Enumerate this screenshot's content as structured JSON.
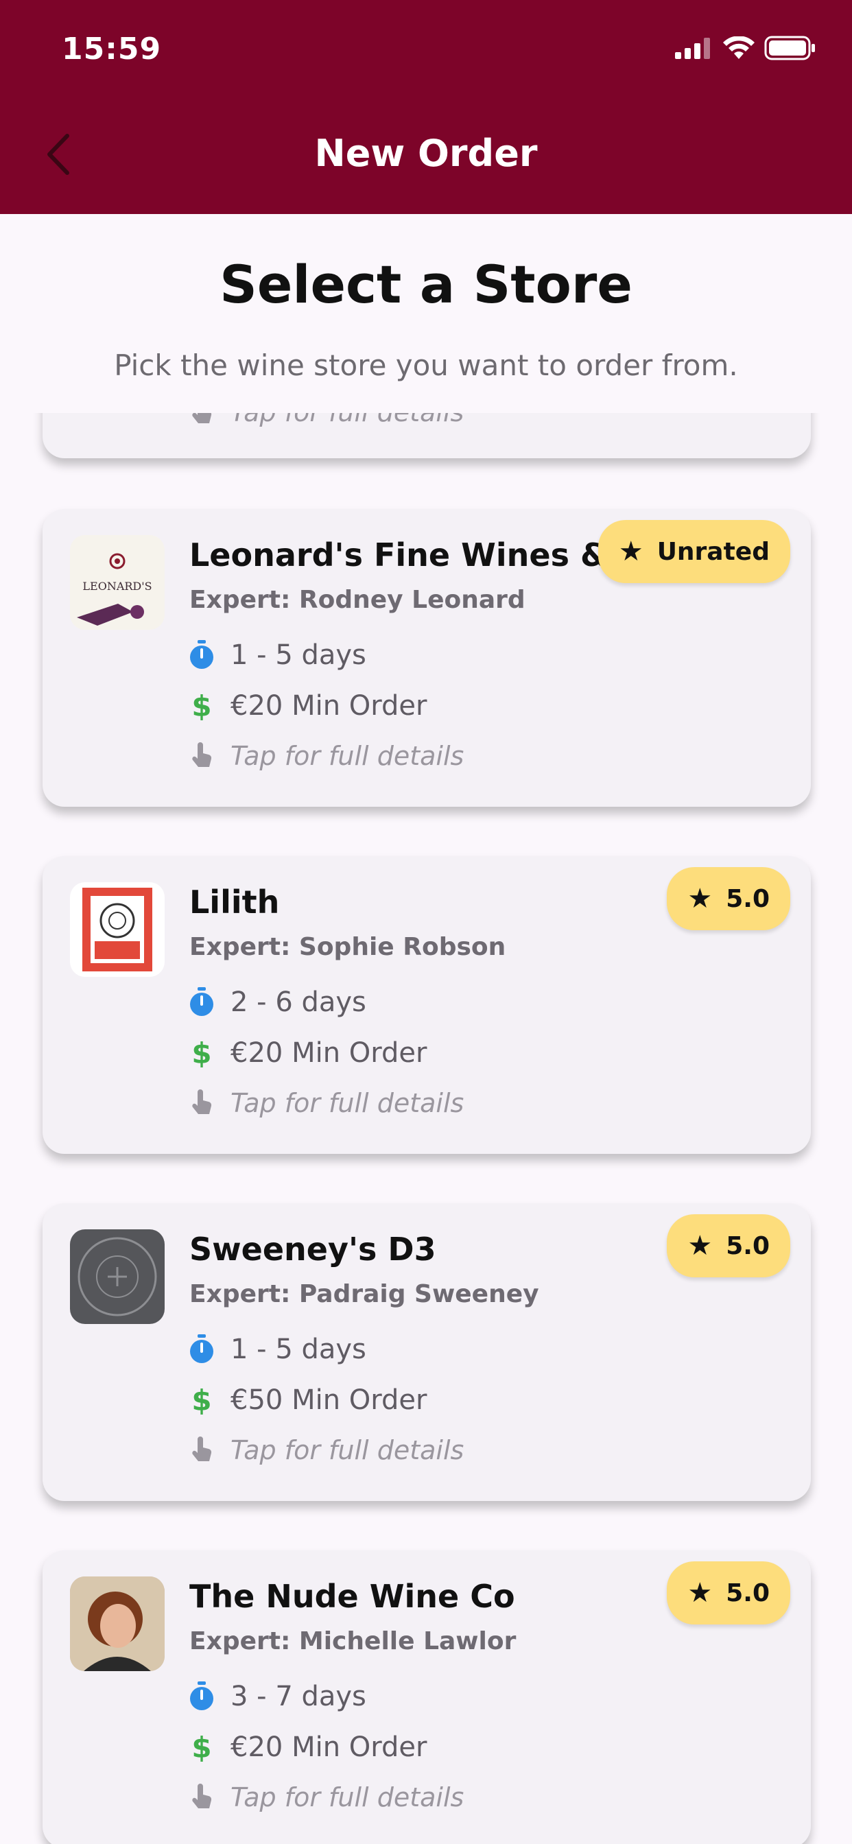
{
  "status_bar": {
    "time": "15:59"
  },
  "appbar": {
    "title": "New Order"
  },
  "header": {
    "title": "Select a Store",
    "subtitle": "Pick the wine store you want to order from."
  },
  "partial_card": {
    "tap_hint": "Tap for full details"
  },
  "stores": [
    {
      "name": "Leonard's Fine Wines &",
      "expert": "Expert: Rodney Leonard",
      "delivery": "1 - 5 days",
      "min_order": "€20 Min Order",
      "tap_hint": "Tap for full details",
      "rating": "Unrated",
      "logo_text": "LEONARD'S"
    },
    {
      "name": "Lilith",
      "expert": "Expert: Sophie Robson",
      "delivery": "2 - 6 days",
      "min_order": "€20 Min Order",
      "tap_hint": "Tap for full details",
      "rating": "5.0"
    },
    {
      "name": "Sweeney's D3",
      "expert": "Expert: Padraig Sweeney",
      "delivery": "1 - 5 days",
      "min_order": "€50 Min Order",
      "tap_hint": "Tap for full details",
      "rating": "5.0"
    },
    {
      "name": "The Nude Wine Co",
      "expert": "Expert: Michelle Lawlor",
      "delivery": "3 - 7 days",
      "min_order": "€20 Min Order",
      "tap_hint": "Tap for full details",
      "rating": "5.0"
    }
  ],
  "colors": {
    "brand": "#7d0429",
    "badge": "#fddd7c",
    "timer_icon": "#2e8de6",
    "dollar_icon": "#3fae4a"
  },
  "icons": {
    "back": "chevron-left-icon",
    "delivery": "stopwatch-icon",
    "min_order": "dollar-icon",
    "tap": "tap-hand-icon",
    "rating": "star-icon"
  }
}
